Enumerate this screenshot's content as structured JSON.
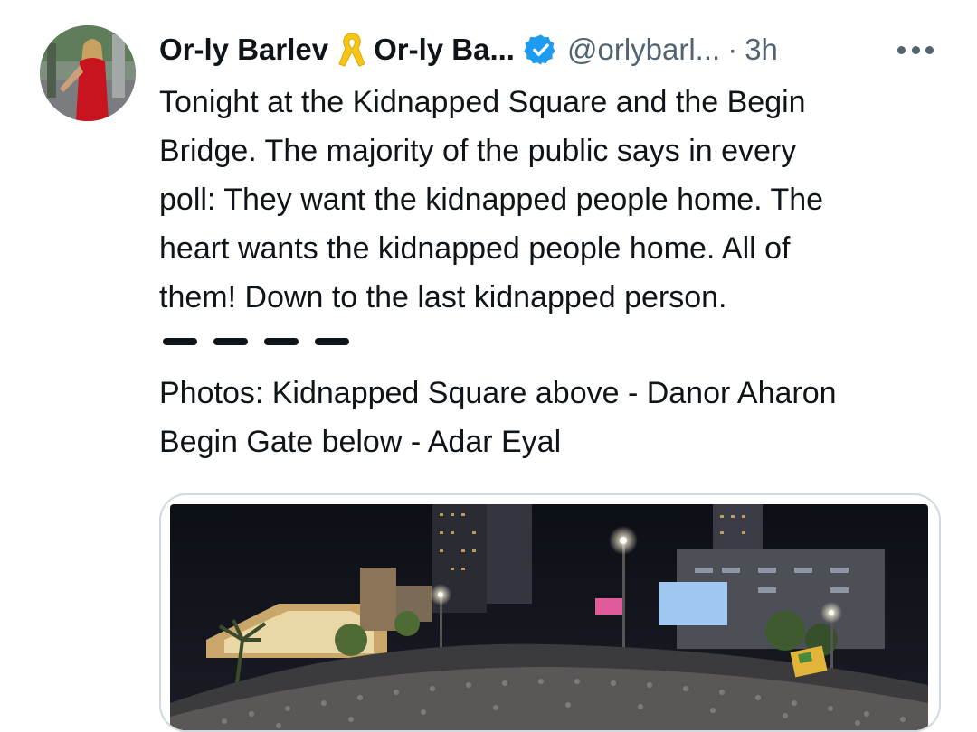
{
  "tweet": {
    "display_name": "Or-ly Barlev",
    "display_name_2": "Or-ly Ba...",
    "handle": "@orlybarl...",
    "separator": "·",
    "time": "3h",
    "lines": [
      "Tonight at the Kidnapped Square and the Begin",
      "Bridge. The majority of the public says in every",
      "poll: They want the kidnapped people home. The",
      "heart wants the kidnapped people home. All of",
      "them! Down to the last kidnapped person."
    ],
    "credits": [
      "Photos: Kidnapped Square above - Danor Aharon",
      "Begin Gate below - Adar Eyal"
    ]
  },
  "icons": {
    "ribbon": "yellow-ribbon-icon",
    "verified": "verified-badge-icon",
    "more": "more-options-icon"
  },
  "colors": {
    "text": "#0f1419",
    "secondary": "#536471",
    "verified_blue": "#1d9bf0",
    "ribbon_yellow": "#f5c518",
    "media_border": "#cfd9de"
  }
}
